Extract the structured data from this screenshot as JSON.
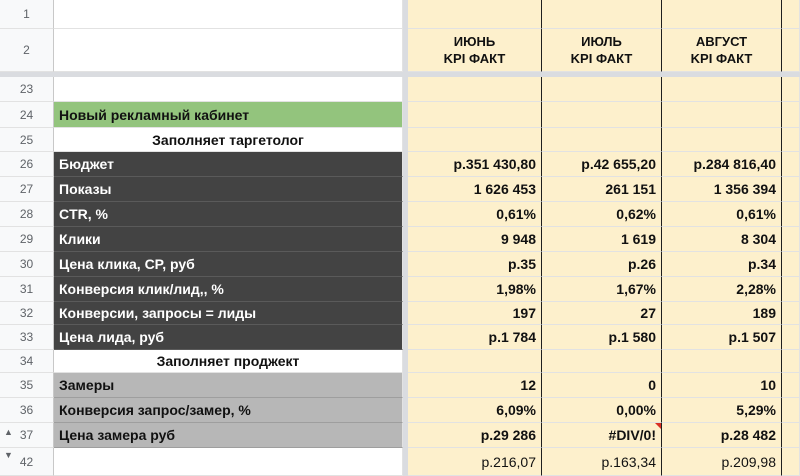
{
  "header": {
    "rows": [
      "1",
      "2"
    ],
    "months": [
      {
        "line1": "ИЮНЬ",
        "line2": "KPI ФАКТ"
      },
      {
        "line1": "ИЮЛЬ",
        "line2": "KPI ФАКТ"
      },
      {
        "line1": "АВГУСТ",
        "line2": "KPI ФАКТ"
      }
    ]
  },
  "rows": [
    {
      "num": "23",
      "label": "",
      "b": "",
      "c": "",
      "d": "",
      "style": "plain"
    },
    {
      "num": "24",
      "label": "Новый рекламный кабинет",
      "b": "",
      "c": "",
      "d": "",
      "style": "green"
    },
    {
      "num": "25",
      "label": "Заполняет таргетолог",
      "b": "",
      "c": "",
      "d": "",
      "style": "section"
    },
    {
      "num": "26",
      "label": "Бюджет",
      "b": "р.351 430,80",
      "c": "р.42 655,20",
      "d": "р.284 816,40",
      "style": "dark"
    },
    {
      "num": "27",
      "label": "Показы",
      "b": "1 626 453",
      "c": "261 151",
      "d": "1 356 394",
      "style": "dark"
    },
    {
      "num": "28",
      "label": "CTR, %",
      "b": "0,61%",
      "c": "0,62%",
      "d": "0,61%",
      "style": "dark"
    },
    {
      "num": "29",
      "label": "Клики",
      "b": "9 948",
      "c": "1 619",
      "d": "8 304",
      "style": "dark"
    },
    {
      "num": "30",
      "label": "Цена клика, CP, руб",
      "b": "р.35",
      "c": "р.26",
      "d": "р.34",
      "style": "dark"
    },
    {
      "num": "31",
      "label": "Конверсия клик/лид,, %",
      "b": "1,98%",
      "c": "1,67%",
      "d": "2,28%",
      "style": "dark"
    },
    {
      "num": "32",
      "label": "Конверсии, запросы = лиды",
      "b": "197",
      "c": "27",
      "d": "189",
      "style": "dark"
    },
    {
      "num": "33",
      "label": "Цена лида, руб",
      "b": "р.1 784",
      "c": "р.1 580",
      "d": "р.1 507",
      "style": "dark"
    },
    {
      "num": "34",
      "label": "Заполняет проджект",
      "b": "",
      "c": "",
      "d": "",
      "style": "section"
    },
    {
      "num": "35",
      "label": "Замеры",
      "b": "12",
      "c": "0",
      "d": "10",
      "style": "grey"
    },
    {
      "num": "36",
      "label": "Конверсия запрос/замер, %",
      "b": "6,09%",
      "c": "0,00%",
      "d": "5,29%",
      "style": "grey"
    },
    {
      "num": "37",
      "label": "Цена замера руб",
      "b": "р.29 286",
      "c": "#DIV/0!",
      "d": "р.28 482",
      "style": "grey"
    },
    {
      "num": "42",
      "label": "",
      "b": "р.216,07",
      "c": "р.163,34",
      "d": "р.209,98",
      "style": "total"
    }
  ],
  "glyphs": {
    "collapse_up": "▲",
    "collapse_down": "▼"
  },
  "colors": {
    "column_fill": "#fdf0cc",
    "green_header": "#93c47d",
    "dark_fill": "#434343",
    "grey_fill": "#b7b7b7",
    "error_flag": "#d93025"
  }
}
